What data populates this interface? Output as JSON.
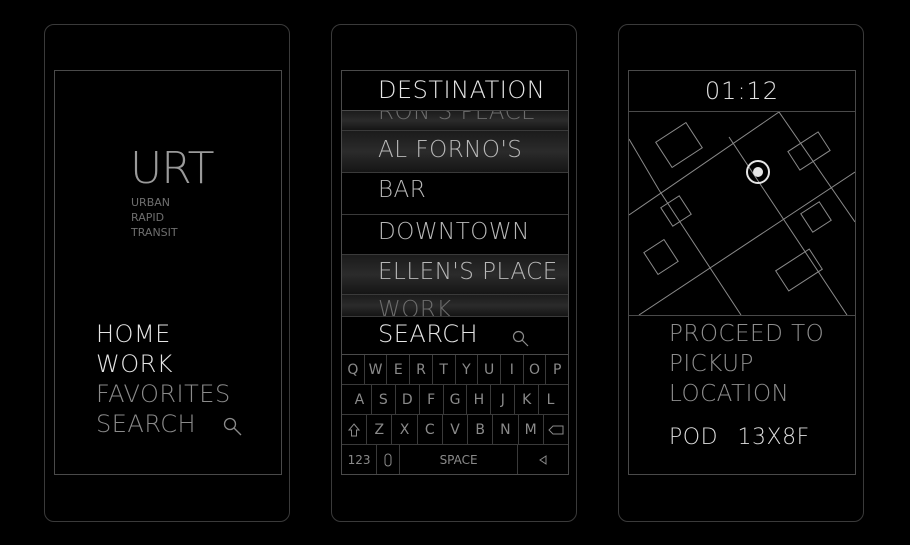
{
  "home_screen": {
    "logo": "URT",
    "logo_lines": [
      "URBAN",
      "RAPID",
      "TRANSIT"
    ],
    "menu": [
      {
        "label": "HOME",
        "active": true
      },
      {
        "label": "WORK",
        "active": true
      },
      {
        "label": "FAVORITES",
        "active": false
      },
      {
        "label": "SEARCH",
        "active": false
      }
    ],
    "search_icon": "search-icon"
  },
  "destination_screen": {
    "title": "DESTINATION",
    "list": [
      "RON'S PLACE",
      "AL FORNO'S",
      "BAR",
      "DOWNTOWN",
      "ELLEN'S PLACE",
      "WORK"
    ],
    "search_label": "SEARCH",
    "keyboard": {
      "row1": [
        "Q",
        "W",
        "E",
        "R",
        "T",
        "Y",
        "U",
        "I",
        "O",
        "P"
      ],
      "row2": [
        "A",
        "S",
        "D",
        "F",
        "G",
        "H",
        "J",
        "K",
        "L"
      ],
      "row3": [
        "Z",
        "X",
        "C",
        "V",
        "B",
        "N",
        "M"
      ],
      "numbers_key": "123",
      "space_key": "SPACE",
      "icons": [
        "shift-icon",
        "backspace-icon",
        "mic-icon",
        "send-icon"
      ]
    }
  },
  "pickup_screen": {
    "timer": "01:12",
    "message_lines": [
      "PROCEED TO",
      "PICKUP",
      "LOCATION"
    ],
    "pod_label": "POD",
    "pod_id": "13X8F",
    "location_icon": "location-target-icon"
  },
  "colors": {
    "background": "#000000",
    "bright_text": "#e5e5e5",
    "dim_text": "#8b8b8b",
    "frame": "#3a3a3a"
  }
}
